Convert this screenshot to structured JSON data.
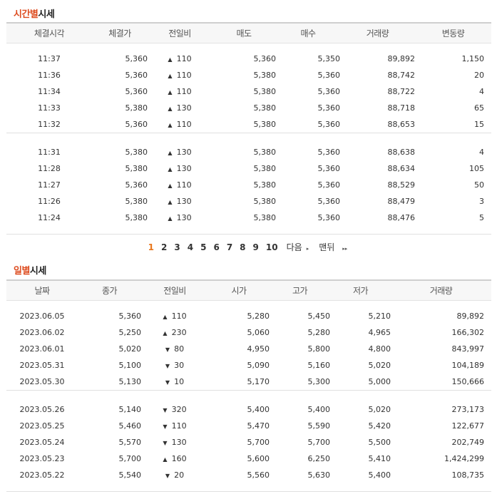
{
  "time_section": {
    "title_accent": "시간별",
    "title_rest": "시세",
    "headers": [
      "체결시각",
      "체결가",
      "전일비",
      "매도",
      "매수",
      "거래량",
      "변동량"
    ],
    "groups": [
      [
        {
          "time": "11:37",
          "price": "5,360",
          "dir": "up",
          "diff": "110",
          "ask": "5,360",
          "bid": "5,350",
          "volume": "89,892",
          "change": "1,150"
        },
        {
          "time": "11:36",
          "price": "5,360",
          "dir": "up",
          "diff": "110",
          "ask": "5,380",
          "bid": "5,360",
          "volume": "88,742",
          "change": "20"
        },
        {
          "time": "11:34",
          "price": "5,360",
          "dir": "up",
          "diff": "110",
          "ask": "5,380",
          "bid": "5,360",
          "volume": "88,722",
          "change": "4"
        },
        {
          "time": "11:33",
          "price": "5,380",
          "dir": "up",
          "diff": "130",
          "ask": "5,380",
          "bid": "5,360",
          "volume": "88,718",
          "change": "65"
        },
        {
          "time": "11:32",
          "price": "5,360",
          "dir": "up",
          "diff": "110",
          "ask": "5,380",
          "bid": "5,360",
          "volume": "88,653",
          "change": "15"
        }
      ],
      [
        {
          "time": "11:31",
          "price": "5,380",
          "dir": "up",
          "diff": "130",
          "ask": "5,380",
          "bid": "5,360",
          "volume": "88,638",
          "change": "4"
        },
        {
          "time": "11:28",
          "price": "5,380",
          "dir": "up",
          "diff": "130",
          "ask": "5,380",
          "bid": "5,360",
          "volume": "88,634",
          "change": "105"
        },
        {
          "time": "11:27",
          "price": "5,360",
          "dir": "up",
          "diff": "110",
          "ask": "5,380",
          "bid": "5,360",
          "volume": "88,529",
          "change": "50"
        },
        {
          "time": "11:26",
          "price": "5,380",
          "dir": "up",
          "diff": "130",
          "ask": "5,380",
          "bid": "5,360",
          "volume": "88,479",
          "change": "3"
        },
        {
          "time": "11:24",
          "price": "5,380",
          "dir": "up",
          "diff": "130",
          "ask": "5,380",
          "bid": "5,360",
          "volume": "88,476",
          "change": "5"
        }
      ]
    ]
  },
  "pagination": {
    "pages": [
      "1",
      "2",
      "3",
      "4",
      "5",
      "6",
      "7",
      "8",
      "9",
      "10"
    ],
    "current": "1",
    "next_label": "다음",
    "last_label": "맨뒤"
  },
  "daily_section": {
    "title_accent": "일별",
    "title_rest": "시세",
    "headers": [
      "날짜",
      "종가",
      "전일비",
      "시가",
      "고가",
      "저가",
      "거래량"
    ],
    "groups": [
      [
        {
          "date": "2023.06.05",
          "close": "5,360",
          "dir": "up",
          "diff": "110",
          "open": "5,280",
          "high": "5,450",
          "low": "5,210",
          "volume": "89,892"
        },
        {
          "date": "2023.06.02",
          "close": "5,250",
          "dir": "up",
          "diff": "230",
          "open": "5,060",
          "high": "5,280",
          "low": "4,965",
          "volume": "166,302"
        },
        {
          "date": "2023.06.01",
          "close": "5,020",
          "dir": "down",
          "diff": "80",
          "open": "4,950",
          "high": "5,800",
          "low": "4,800",
          "volume": "843,997"
        },
        {
          "date": "2023.05.31",
          "close": "5,100",
          "dir": "down",
          "diff": "30",
          "open": "5,090",
          "high": "5,160",
          "low": "5,020",
          "volume": "104,189"
        },
        {
          "date": "2023.05.30",
          "close": "5,130",
          "dir": "down",
          "diff": "10",
          "open": "5,170",
          "high": "5,300",
          "low": "5,000",
          "volume": "150,666"
        }
      ],
      [
        {
          "date": "2023.05.26",
          "close": "5,140",
          "dir": "down",
          "diff": "320",
          "open": "5,400",
          "high": "5,400",
          "low": "5,020",
          "volume": "273,173"
        },
        {
          "date": "2023.05.25",
          "close": "5,460",
          "dir": "down",
          "diff": "110",
          "open": "5,470",
          "high": "5,590",
          "low": "5,420",
          "volume": "122,677"
        },
        {
          "date": "2023.05.24",
          "close": "5,570",
          "dir": "down",
          "diff": "130",
          "open": "5,700",
          "high": "5,700",
          "low": "5,500",
          "volume": "202,749"
        },
        {
          "date": "2023.05.23",
          "close": "5,700",
          "dir": "up",
          "diff": "160",
          "open": "5,600",
          "high": "6,250",
          "low": "5,410",
          "volume": "1,424,299"
        },
        {
          "date": "2023.05.22",
          "close": "5,540",
          "dir": "down",
          "diff": "20",
          "open": "5,560",
          "high": "5,630",
          "low": "5,400",
          "volume": "108,735"
        }
      ]
    ]
  },
  "symbols": {
    "up": "▲",
    "down": "▼",
    "next_tri": "▸",
    "last_tri": "▸▸"
  },
  "colors": {
    "up": "#d0021b",
    "down": "#1467c8",
    "accent": "#dd4b1e",
    "current_page": "#e8771e"
  }
}
